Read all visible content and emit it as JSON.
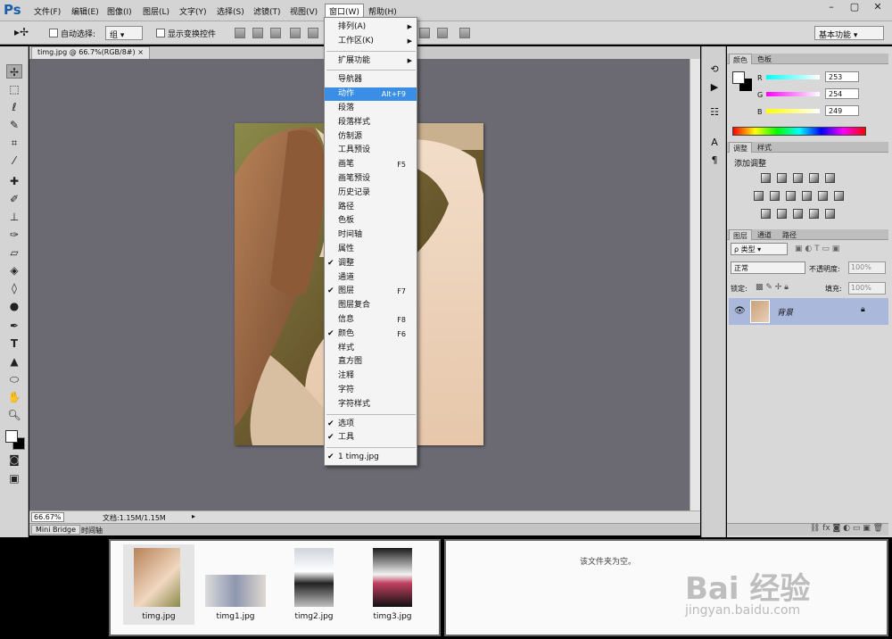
{
  "app": {
    "logo": "Ps"
  },
  "menubar": {
    "items": [
      "文件(F)",
      "编辑(E)",
      "图像(I)",
      "图层(L)",
      "文字(Y)",
      "选择(S)",
      "滤镜(T)",
      "视图(V)",
      "窗口(W)",
      "帮助(H)"
    ],
    "active_index": 8,
    "window_buttons": [
      "–",
      "▢",
      "✕"
    ]
  },
  "options": {
    "auto_select_label": "自动选择:",
    "auto_select_value": "组",
    "show_transform_label": "显示变换控件",
    "workspace": "基本功能"
  },
  "document": {
    "tab_title": "timg.jpg @ 66.7%(RGB/8#)",
    "zoom": "66.67%",
    "doc_info": "文档:1.15M/1.15M"
  },
  "bottom_tabs": [
    "Mini Bridge",
    "时间轴"
  ],
  "window_menu": {
    "items": [
      {
        "label": "排列(A)",
        "arrow": true
      },
      {
        "label": "工作区(K)",
        "arrow": true
      },
      {
        "sep": true
      },
      {
        "label": "扩展功能",
        "arrow": true
      },
      {
        "sep": true
      },
      {
        "label": "导航器"
      },
      {
        "label": "动作",
        "shortcut": "Alt+F9",
        "highlight": true
      },
      {
        "label": "段落"
      },
      {
        "label": "段落样式"
      },
      {
        "label": "仿制源"
      },
      {
        "label": "工具预设"
      },
      {
        "label": "画笔",
        "shortcut": "F5"
      },
      {
        "label": "画笔预设"
      },
      {
        "label": "历史记录"
      },
      {
        "label": "路径"
      },
      {
        "label": "色板"
      },
      {
        "label": "时间轴"
      },
      {
        "label": "属性"
      },
      {
        "label": "调整",
        "checked": true
      },
      {
        "label": "通道"
      },
      {
        "label": "图层",
        "shortcut": "F7",
        "checked": true
      },
      {
        "label": "图层复合"
      },
      {
        "label": "信息",
        "shortcut": "F8"
      },
      {
        "label": "颜色",
        "shortcut": "F6",
        "checked": true
      },
      {
        "label": "样式"
      },
      {
        "label": "直方图"
      },
      {
        "label": "注释"
      },
      {
        "label": "字符"
      },
      {
        "label": "字符样式"
      },
      {
        "sep": true
      },
      {
        "label": "选项",
        "checked": true
      },
      {
        "label": "工具",
        "checked": true
      },
      {
        "sep": true
      },
      {
        "label": "1 timg.jpg",
        "checked": true
      }
    ]
  },
  "color_panel": {
    "tabs": [
      "颜色",
      "色板"
    ],
    "r_label": "R",
    "g_label": "G",
    "b_label": "B",
    "r": "253",
    "g": "254",
    "b": "249"
  },
  "adjust_panel": {
    "tabs": [
      "调整",
      "样式"
    ],
    "title": "添加调整"
  },
  "layers_panel": {
    "tabs": [
      "图层",
      "通道",
      "路径"
    ],
    "filter": "ρ 类型",
    "blend_mode": "正常",
    "opacity_label": "不透明度:",
    "opacity": "100%",
    "lock_label": "锁定:",
    "fill_label": "填充:",
    "fill": "100%",
    "layer_name": "背景"
  },
  "bridge": {
    "thumbs": [
      "timg.jpg",
      "timg1.jpg",
      "timg2.jpg",
      "timg3.jpg"
    ],
    "empty_text": "该文件夹为空。"
  },
  "watermark": {
    "brand": "Bai 经验",
    "url": "jingyan.baidu.com"
  },
  "colors": {
    "highlight": "#3a8ee6",
    "canvas_bg": "#6b6a73",
    "layer_selected": "#a9b8db"
  }
}
